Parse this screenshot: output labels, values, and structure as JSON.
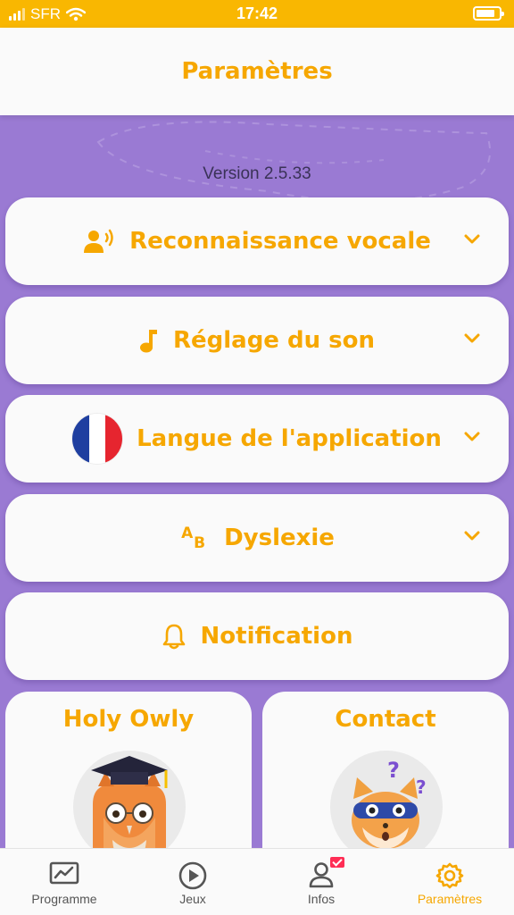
{
  "status_bar": {
    "carrier": "SFR",
    "time": "17:42"
  },
  "header": {
    "title": "Paramètres"
  },
  "version": "Version 2.5.33",
  "settings": [
    {
      "label": "Reconnaissance vocale",
      "icon": "voice-recognition-icon",
      "expandable": true
    },
    {
      "label": "Réglage du son",
      "icon": "music-note-icon",
      "expandable": true
    },
    {
      "label": "Langue de l'application",
      "icon": "french-flag-icon",
      "expandable": true
    },
    {
      "label": "Dyslexie",
      "icon": "ab-text-icon",
      "expandable": true
    },
    {
      "label": "Notification",
      "icon": "bell-icon",
      "expandable": false
    }
  ],
  "tiles": [
    {
      "title": "Holy Owly",
      "image": "owl-graduate-avatar"
    },
    {
      "title": "Contact",
      "image": "fox-question-avatar"
    }
  ],
  "tabbar": [
    {
      "label": "Programme",
      "icon": "chart-icon",
      "active": false
    },
    {
      "label": "Jeux",
      "icon": "play-icon",
      "active": false
    },
    {
      "label": "Infos",
      "icon": "user-icon",
      "active": false,
      "badge": "mail"
    },
    {
      "label": "Paramètres",
      "icon": "gear-icon",
      "active": true
    }
  ],
  "colors": {
    "accent": "#f6a700",
    "status_bar": "#f9b701",
    "background": "#9a7ad3",
    "card": "#fafafa",
    "flag_blue": "#1f3fa0",
    "flag_red": "#e6252f"
  }
}
